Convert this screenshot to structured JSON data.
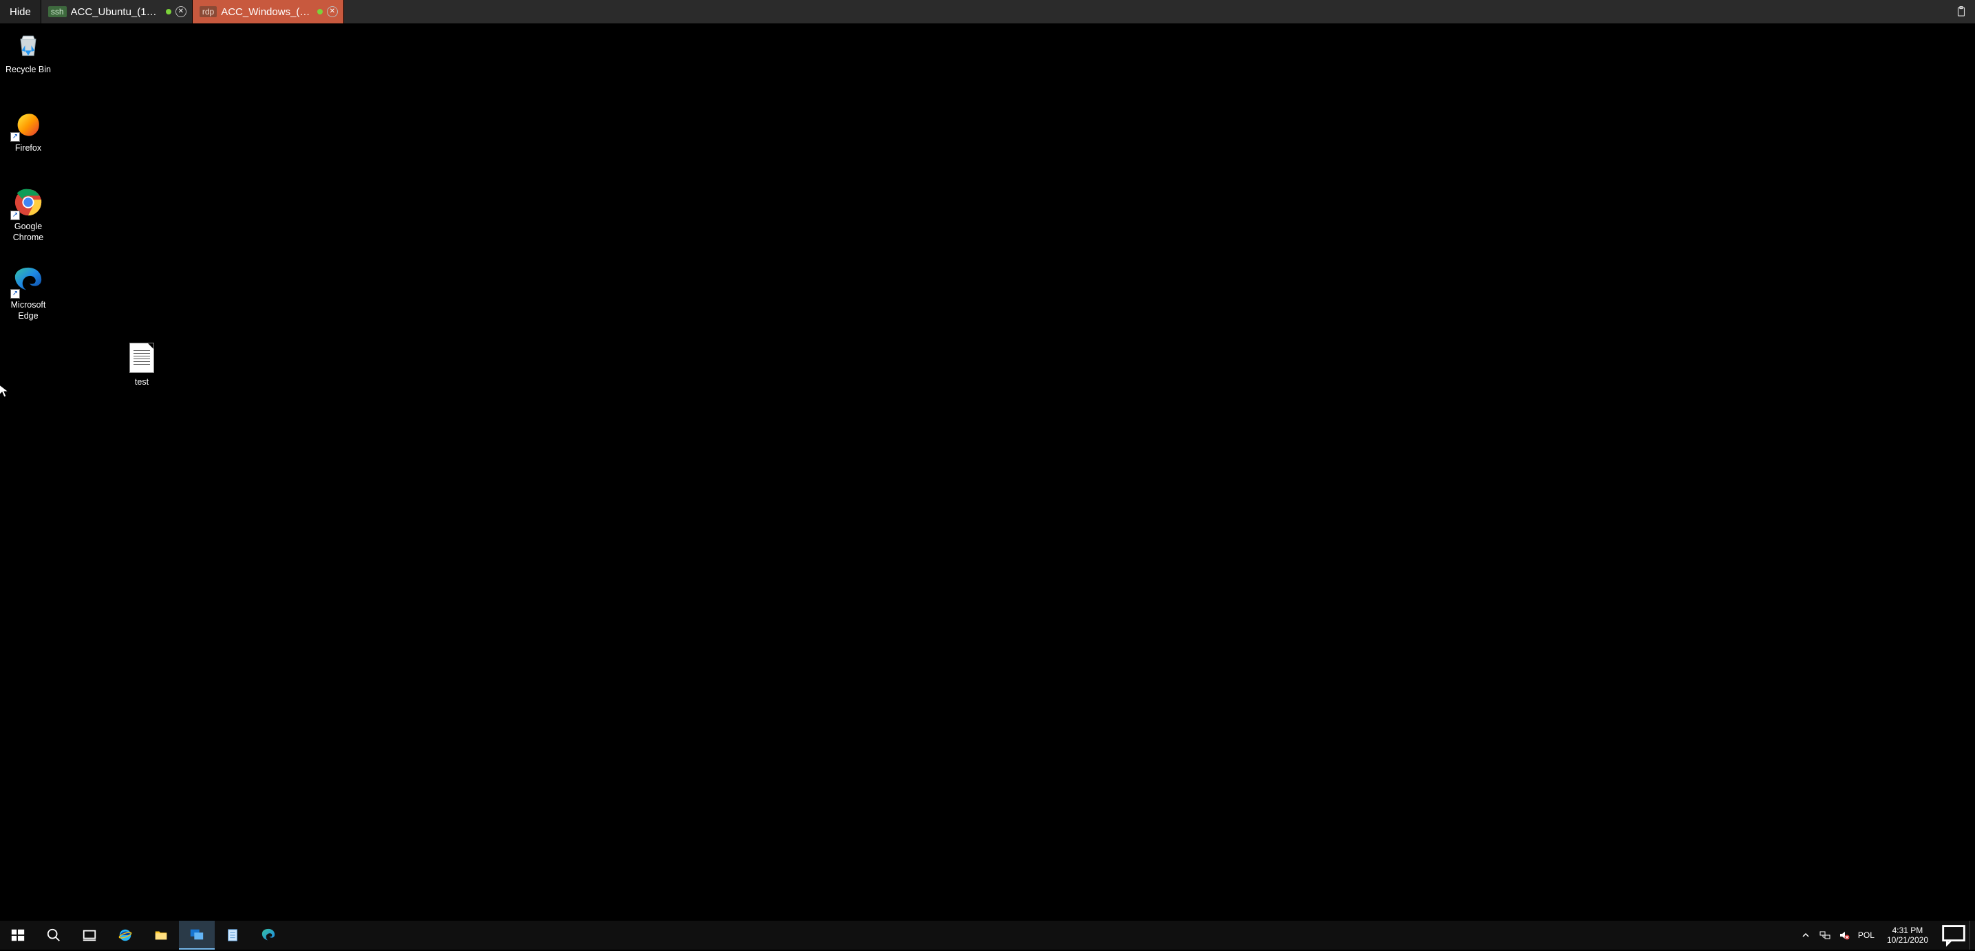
{
  "client_bar": {
    "hide_label": "Hide",
    "tabs": [
      {
        "protocol": "ssh",
        "title": "ACC_Ubuntu_(10.0…",
        "status": "connected",
        "active": false
      },
      {
        "protocol": "rdp",
        "title": "ACC_Windows_(10…",
        "status": "connected",
        "active": true
      }
    ]
  },
  "desktop_icons": [
    {
      "id": "recycle-bin",
      "label": "Recycle Bin",
      "col": 0,
      "row": 0,
      "shortcut": false
    },
    {
      "id": "firefox",
      "label": "Firefox",
      "col": 0,
      "row": 1,
      "shortcut": true
    },
    {
      "id": "google-chrome",
      "label": "Google Chrome",
      "col": 0,
      "row": 2,
      "shortcut": true
    },
    {
      "id": "microsoft-edge",
      "label": "Microsoft Edge",
      "col": 0,
      "row": 3,
      "shortcut": true
    },
    {
      "id": "test",
      "label": "test",
      "col": 2,
      "row": 4,
      "shortcut": false
    }
  ],
  "taskbar": {
    "apps": [
      {
        "id": "start",
        "icon": "windows-logo"
      },
      {
        "id": "search",
        "icon": "magnifier"
      },
      {
        "id": "task-view",
        "icon": "task-view"
      },
      {
        "id": "internet-explorer",
        "icon": "ie"
      },
      {
        "id": "file-explorer",
        "icon": "folder"
      },
      {
        "id": "rdp-client",
        "icon": "rdp",
        "active": true
      },
      {
        "id": "notepad",
        "icon": "notepad"
      },
      {
        "id": "edge",
        "icon": "edge"
      }
    ],
    "tray": {
      "chevron": "▲",
      "lang": "POL",
      "time": "4:31 PM",
      "date": "10/21/2020"
    }
  }
}
